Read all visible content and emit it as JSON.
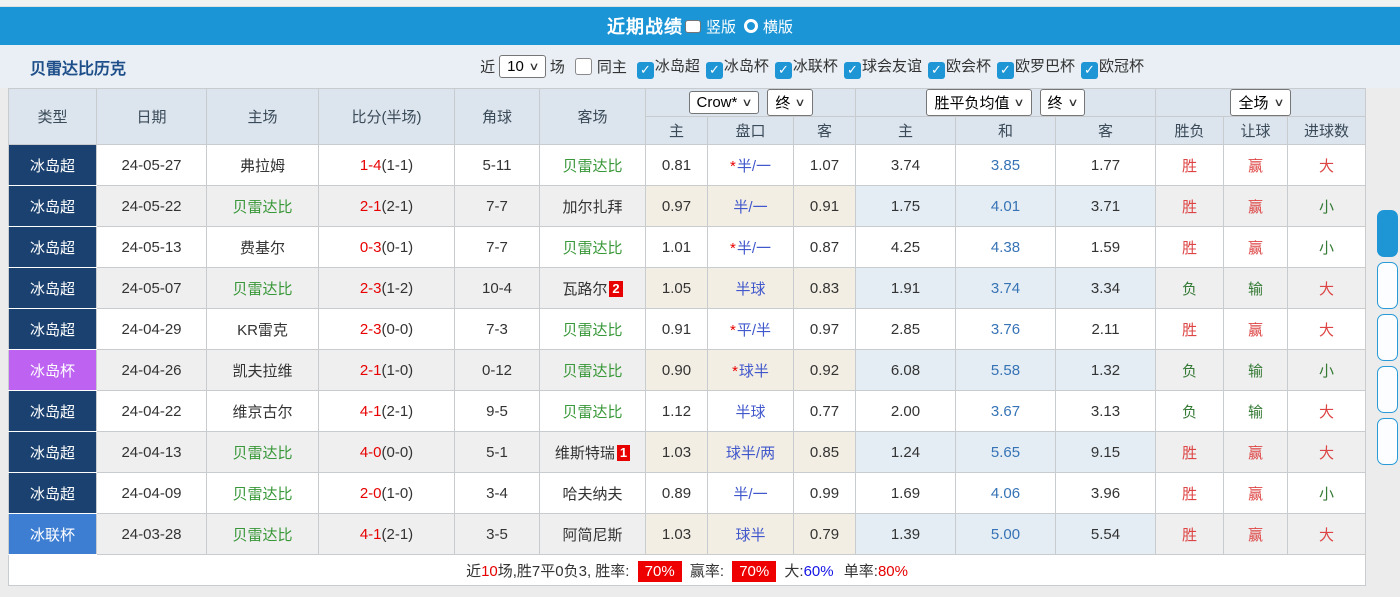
{
  "header": {
    "title": "近期战绩",
    "radios": [
      {
        "label": "竖版",
        "selected": true
      },
      {
        "label": "横版",
        "selected": false
      }
    ]
  },
  "filter": {
    "team": "贝雷达比历克",
    "near_label": "近",
    "count_value": "10",
    "games_label": "场",
    "same_home": {
      "label": "同主",
      "checked": false
    },
    "leagues": [
      {
        "label": "冰岛超",
        "checked": true
      },
      {
        "label": "冰岛杯",
        "checked": true
      },
      {
        "label": "冰联杯",
        "checked": true
      },
      {
        "label": "球会友谊",
        "checked": true
      },
      {
        "label": "欧会杯",
        "checked": true
      },
      {
        "label": "欧罗巴杯",
        "checked": true
      },
      {
        "label": "欧冠杯",
        "checked": true
      }
    ]
  },
  "table": {
    "columns": [
      "类型",
      "日期",
      "主场",
      "比分(半场)",
      "角球",
      "客场"
    ],
    "subcolumns": [
      "主",
      "盘口",
      "客",
      "主",
      "和",
      "客",
      "胜负",
      "让球",
      "进球数"
    ],
    "selects": {
      "company": "Crow*",
      "company_state": "终",
      "avg": "胜平负均值",
      "avg_state": "终",
      "scope": "全场"
    },
    "rows": [
      {
        "league": "冰岛超",
        "date": "24-05-27",
        "home": "弗拉姆",
        "home_green": false,
        "ft": "1-4",
        "ht": "(1-1)",
        "corner": "5-11",
        "away": "贝雷达比",
        "away_green": true,
        "away_badge": "",
        "odds_home": "0.81",
        "star": true,
        "handicap": "半/一",
        "odds_away": "1.07",
        "avg_win": "3.74",
        "avg_draw": "3.85",
        "avg_loss": "1.77",
        "result": "胜",
        "let_result": "赢",
        "goals": "大"
      },
      {
        "league": "冰岛超",
        "date": "24-05-22",
        "home": "贝雷达比",
        "home_green": true,
        "ft": "2-1",
        "ht": "(2-1)",
        "corner": "7-7",
        "away": "加尔扎拜",
        "away_green": false,
        "away_badge": "",
        "odds_home": "0.97",
        "star": false,
        "handicap": "半/一",
        "odds_away": "0.91",
        "avg_win": "1.75",
        "avg_draw": "4.01",
        "avg_loss": "3.71",
        "result": "胜",
        "let_result": "赢",
        "goals": "小"
      },
      {
        "league": "冰岛超",
        "date": "24-05-13",
        "home": "费基尔",
        "home_green": false,
        "ft": "0-3",
        "ht": "(0-1)",
        "corner": "7-7",
        "away": "贝雷达比",
        "away_green": true,
        "away_badge": "",
        "odds_home": "1.01",
        "star": true,
        "handicap": "半/一",
        "odds_away": "0.87",
        "avg_win": "4.25",
        "avg_draw": "4.38",
        "avg_loss": "1.59",
        "result": "胜",
        "let_result": "赢",
        "goals": "小"
      },
      {
        "league": "冰岛超",
        "date": "24-05-07",
        "home": "贝雷达比",
        "home_green": true,
        "ft": "2-3",
        "ht": "(1-2)",
        "corner": "10-4",
        "away": "瓦路尔",
        "away_green": false,
        "away_badge": "2",
        "odds_home": "1.05",
        "star": false,
        "handicap": "半球",
        "odds_away": "0.83",
        "avg_win": "1.91",
        "avg_draw": "3.74",
        "avg_loss": "3.34",
        "result": "负",
        "let_result": "输",
        "goals": "大"
      },
      {
        "league": "冰岛超",
        "date": "24-04-29",
        "home": "KR雷克",
        "home_green": false,
        "ft": "2-3",
        "ht": "(0-0)",
        "corner": "7-3",
        "away": "贝雷达比",
        "away_green": true,
        "away_badge": "",
        "odds_home": "0.91",
        "star": true,
        "handicap": "平/半",
        "odds_away": "0.97",
        "avg_win": "2.85",
        "avg_draw": "3.76",
        "avg_loss": "2.11",
        "result": "胜",
        "let_result": "赢",
        "goals": "大"
      },
      {
        "league": "冰岛杯",
        "date": "24-04-26",
        "home": "凯夫拉维",
        "home_green": false,
        "ft": "2-1",
        "ht": "(1-0)",
        "corner": "0-12",
        "away": "贝雷达比",
        "away_green": true,
        "away_badge": "",
        "odds_home": "0.90",
        "star": true,
        "handicap": "球半",
        "odds_away": "0.92",
        "avg_win": "6.08",
        "avg_draw": "5.58",
        "avg_loss": "1.32",
        "result": "负",
        "let_result": "输",
        "goals": "小"
      },
      {
        "league": "冰岛超",
        "date": "24-04-22",
        "home": "维京古尔",
        "home_green": false,
        "ft": "4-1",
        "ht": "(2-1)",
        "corner": "9-5",
        "away": "贝雷达比",
        "away_green": true,
        "away_badge": "",
        "odds_home": "1.12",
        "star": false,
        "handicap": "半球",
        "odds_away": "0.77",
        "avg_win": "2.00",
        "avg_draw": "3.67",
        "avg_loss": "3.13",
        "result": "负",
        "let_result": "输",
        "goals": "大"
      },
      {
        "league": "冰岛超",
        "date": "24-04-13",
        "home": "贝雷达比",
        "home_green": true,
        "ft": "4-0",
        "ht": "(0-0)",
        "corner": "5-1",
        "away": "维斯特瑞",
        "away_green": false,
        "away_badge": "1",
        "odds_home": "1.03",
        "star": false,
        "handicap": "球半/两",
        "odds_away": "0.85",
        "avg_win": "1.24",
        "avg_draw": "5.65",
        "avg_loss": "9.15",
        "result": "胜",
        "let_result": "赢",
        "goals": "大"
      },
      {
        "league": "冰岛超",
        "date": "24-04-09",
        "home": "贝雷达比",
        "home_green": true,
        "ft": "2-0",
        "ht": "(1-0)",
        "corner": "3-4",
        "away": "哈夫纳夫",
        "away_green": false,
        "away_badge": "",
        "odds_home": "0.89",
        "star": false,
        "handicap": "半/一",
        "odds_away": "0.99",
        "avg_win": "1.69",
        "avg_draw": "4.06",
        "avg_loss": "3.96",
        "result": "胜",
        "let_result": "赢",
        "goals": "小"
      },
      {
        "league": "冰联杯",
        "date": "24-03-28",
        "home": "贝雷达比",
        "home_green": true,
        "ft": "4-1",
        "ht": "(2-1)",
        "corner": "3-5",
        "away": "阿简尼斯",
        "away_green": false,
        "away_badge": "",
        "odds_home": "1.03",
        "star": false,
        "handicap": "球半",
        "odds_away": "0.79",
        "avg_win": "1.39",
        "avg_draw": "5.00",
        "avg_loss": "5.54",
        "result": "胜",
        "let_result": "赢",
        "goals": "大"
      }
    ]
  },
  "footer": {
    "prefix": "近",
    "count": "10",
    "summary": "场,胜7平0负3, 胜率:",
    "win_rate": "70%",
    "let_label": "赢率:",
    "let_rate": "70%",
    "big_label": "大:",
    "big_rate": "60%",
    "single_label": "单率:",
    "single_rate": "80%"
  },
  "colors": {
    "accent_blue": "#1b95d6",
    "league": {
      "冰岛超": "#1a4170",
      "冰岛杯": "#bd62f1",
      "冰联杯": "#3d7ed3"
    },
    "score_red": "#e80000",
    "handicap_blue": "#4158cc",
    "avg_blue": "#3673b5",
    "result_red": "#dd4444",
    "result_green": "#357a35"
  }
}
